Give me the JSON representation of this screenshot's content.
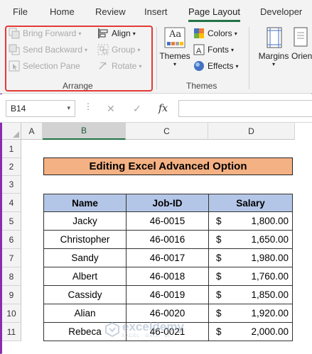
{
  "tabs": [
    "File",
    "Home",
    "Review",
    "Insert",
    "Page Layout",
    "Developer"
  ],
  "active_tab": "Page Layout",
  "ribbon": {
    "arrange": {
      "bring_forward": "Bring Forward",
      "send_backward": "Send Backward",
      "selection_pane": "Selection Pane",
      "align": "Align",
      "group": "Group",
      "rotate": "Rotate",
      "label": "Arrange"
    },
    "themes": {
      "themes": "Themes",
      "colors": "Colors",
      "fonts": "Fonts",
      "effects": "Effects",
      "label": "Themes",
      "theme_icon_text": "Aa"
    },
    "page_setup": {
      "margins": "Margins",
      "orientation": "Orien"
    }
  },
  "formula_bar": {
    "name_box": "B14",
    "cancel": "✕",
    "enter": "✓",
    "fx": "fx",
    "value": ""
  },
  "sheet": {
    "columns": [
      "A",
      "B",
      "C",
      "D"
    ],
    "selected_column": "B",
    "rows": [
      "1",
      "2",
      "3",
      "4",
      "5",
      "6",
      "7",
      "8",
      "9",
      "10",
      "11"
    ],
    "title": "Editing Excel Advanced Option",
    "headers": [
      "Name",
      "Job-ID",
      "Salary"
    ],
    "records": [
      {
        "name": "Jacky",
        "job": "46-0015",
        "cur": "$",
        "salary": "1,800.00"
      },
      {
        "name": "Christopher",
        "job": "46-0016",
        "cur": "$",
        "salary": "1,650.00"
      },
      {
        "name": "Sandy",
        "job": "46-0017",
        "cur": "$",
        "salary": "1,980.00"
      },
      {
        "name": "Albert",
        "job": "46-0018",
        "cur": "$",
        "salary": "1,760.00"
      },
      {
        "name": "Cassidy",
        "job": "46-0019",
        "cur": "$",
        "salary": "1,850.00"
      },
      {
        "name": "Alian",
        "job": "46-0020",
        "cur": "$",
        "salary": "1,920.00"
      },
      {
        "name": "Rebeca",
        "job": "46-0021",
        "cur": "$",
        "salary": "2,000.00"
      }
    ]
  },
  "watermark": {
    "name": "exceldemy",
    "sub": "EXCEL · DATA · BI"
  },
  "colors": {
    "accent": "#217346",
    "highlight_box": "#e53935",
    "title_fill": "#f4b183",
    "header_fill": "#b4c6e7"
  }
}
